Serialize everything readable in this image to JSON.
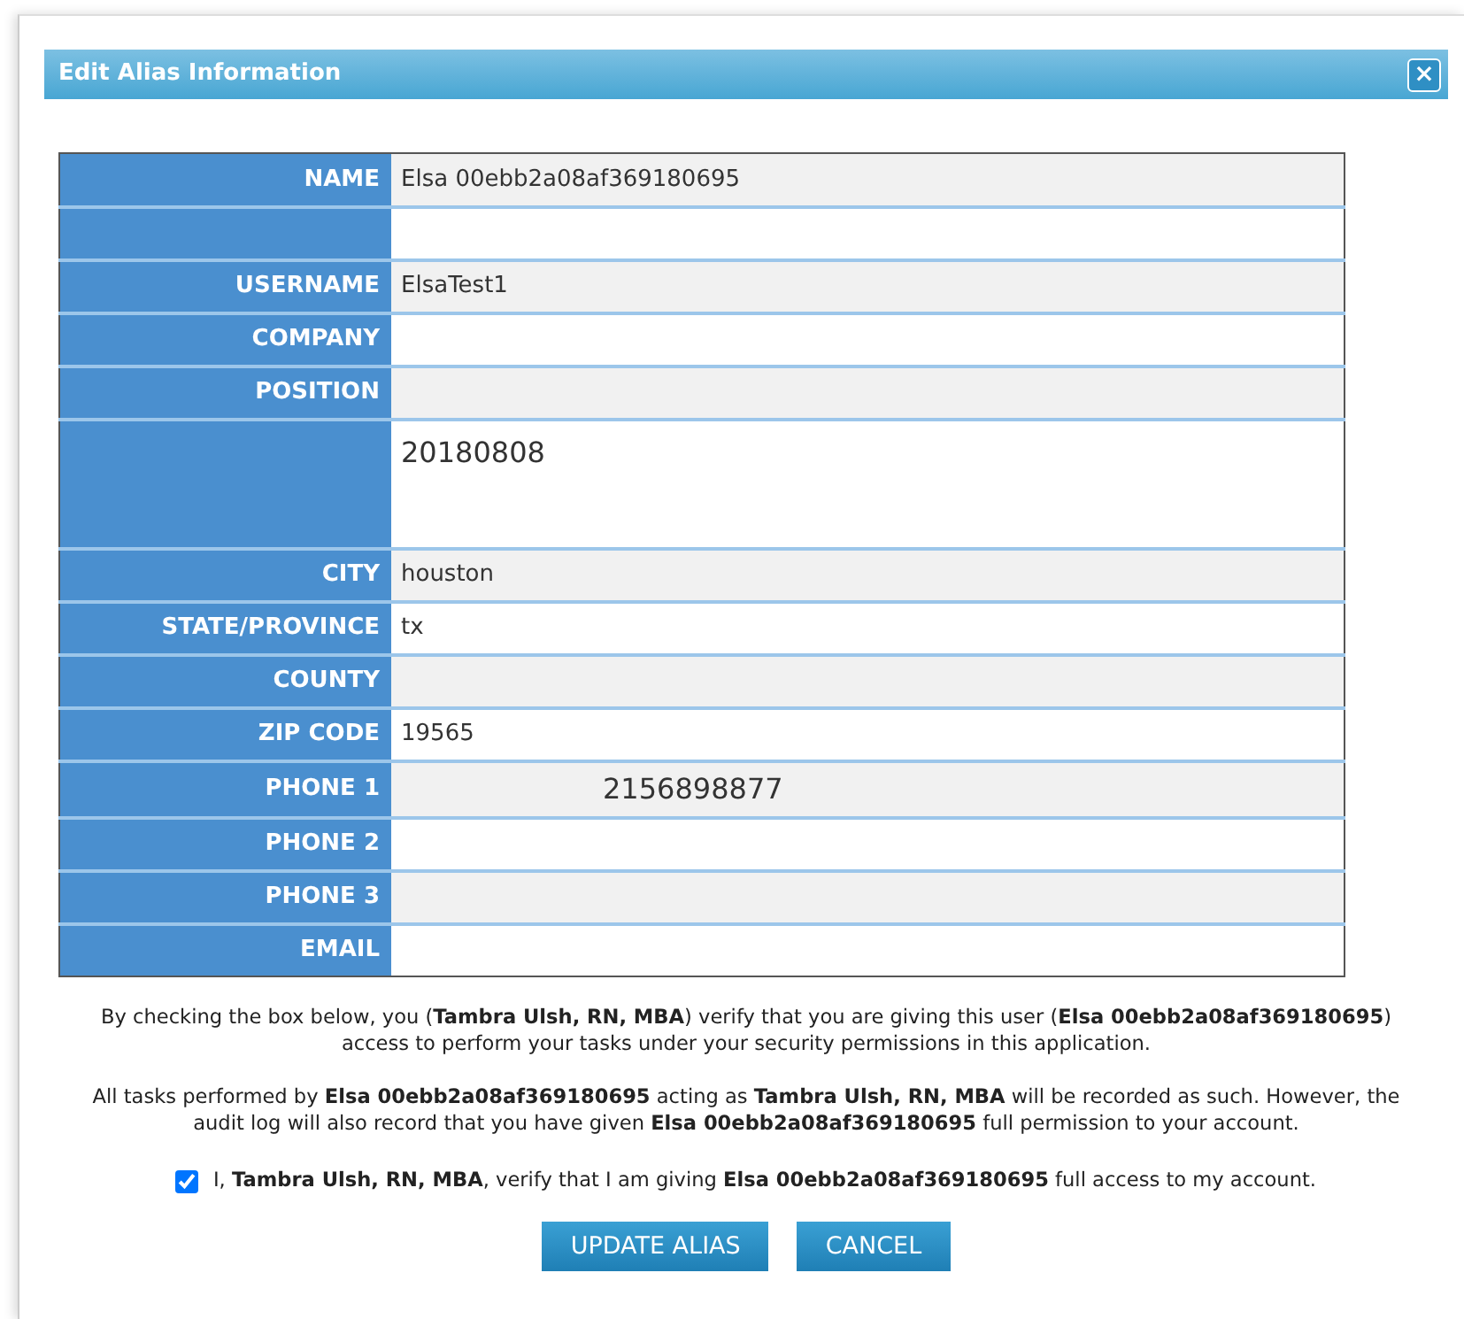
{
  "dialog": {
    "title": "Edit Alias Information",
    "close": "×"
  },
  "fields": [
    {
      "label": "NAME",
      "value": "Elsa 00ebb2a08af369180695",
      "kind": "text"
    },
    {
      "kind": "text"
    },
    {
      "label": "USERNAME",
      "value": "ElsaTest1",
      "kind": "text"
    },
    {
      "label": "COMPANY",
      "kind": "text"
    },
    {
      "label": "POSITION",
      "kind": "text"
    },
    {
      "value": "20180808",
      "kind": "memo"
    },
    {
      "label": "CITY",
      "value": "houston",
      "kind": "text"
    },
    {
      "label": "STATE/PROVINCE",
      "value": "tx",
      "kind": "text"
    },
    {
      "label": "COUNTY",
      "kind": "text"
    },
    {
      "label": "ZIP CODE",
      "value": "19565",
      "kind": "text"
    },
    {
      "label": "PHONE 1",
      "value": "2156898877",
      "kind": "offset"
    },
    {
      "label": "PHONE 2",
      "kind": "text"
    },
    {
      "label": "PHONE 3",
      "kind": "text"
    },
    {
      "label": "EMAIL",
      "kind": "text"
    }
  ],
  "notices": [
    "By checking the box below, you (**Tambra Ulsh, RN, MBA**) verify that you are giving this user (**Elsa 00ebb2a08af369180695**) access to perform your tasks under your security permissions in this application.",
    "All tasks performed by **Elsa 00ebb2a08af369180695** acting as **Tambra Ulsh, RN, MBA** will be recorded as such. However, the audit log will also record that you have given **Elsa 00ebb2a08af369180695** full permission to your account."
  ],
  "consent": {
    "checked": true,
    "text": "I, **Tambra Ulsh, RN, MBA**, verify that I am giving **Elsa 00ebb2a08af369180695** full access to my account."
  },
  "buttons": [
    "UPDATE ALIAS",
    "CANCEL"
  ]
}
